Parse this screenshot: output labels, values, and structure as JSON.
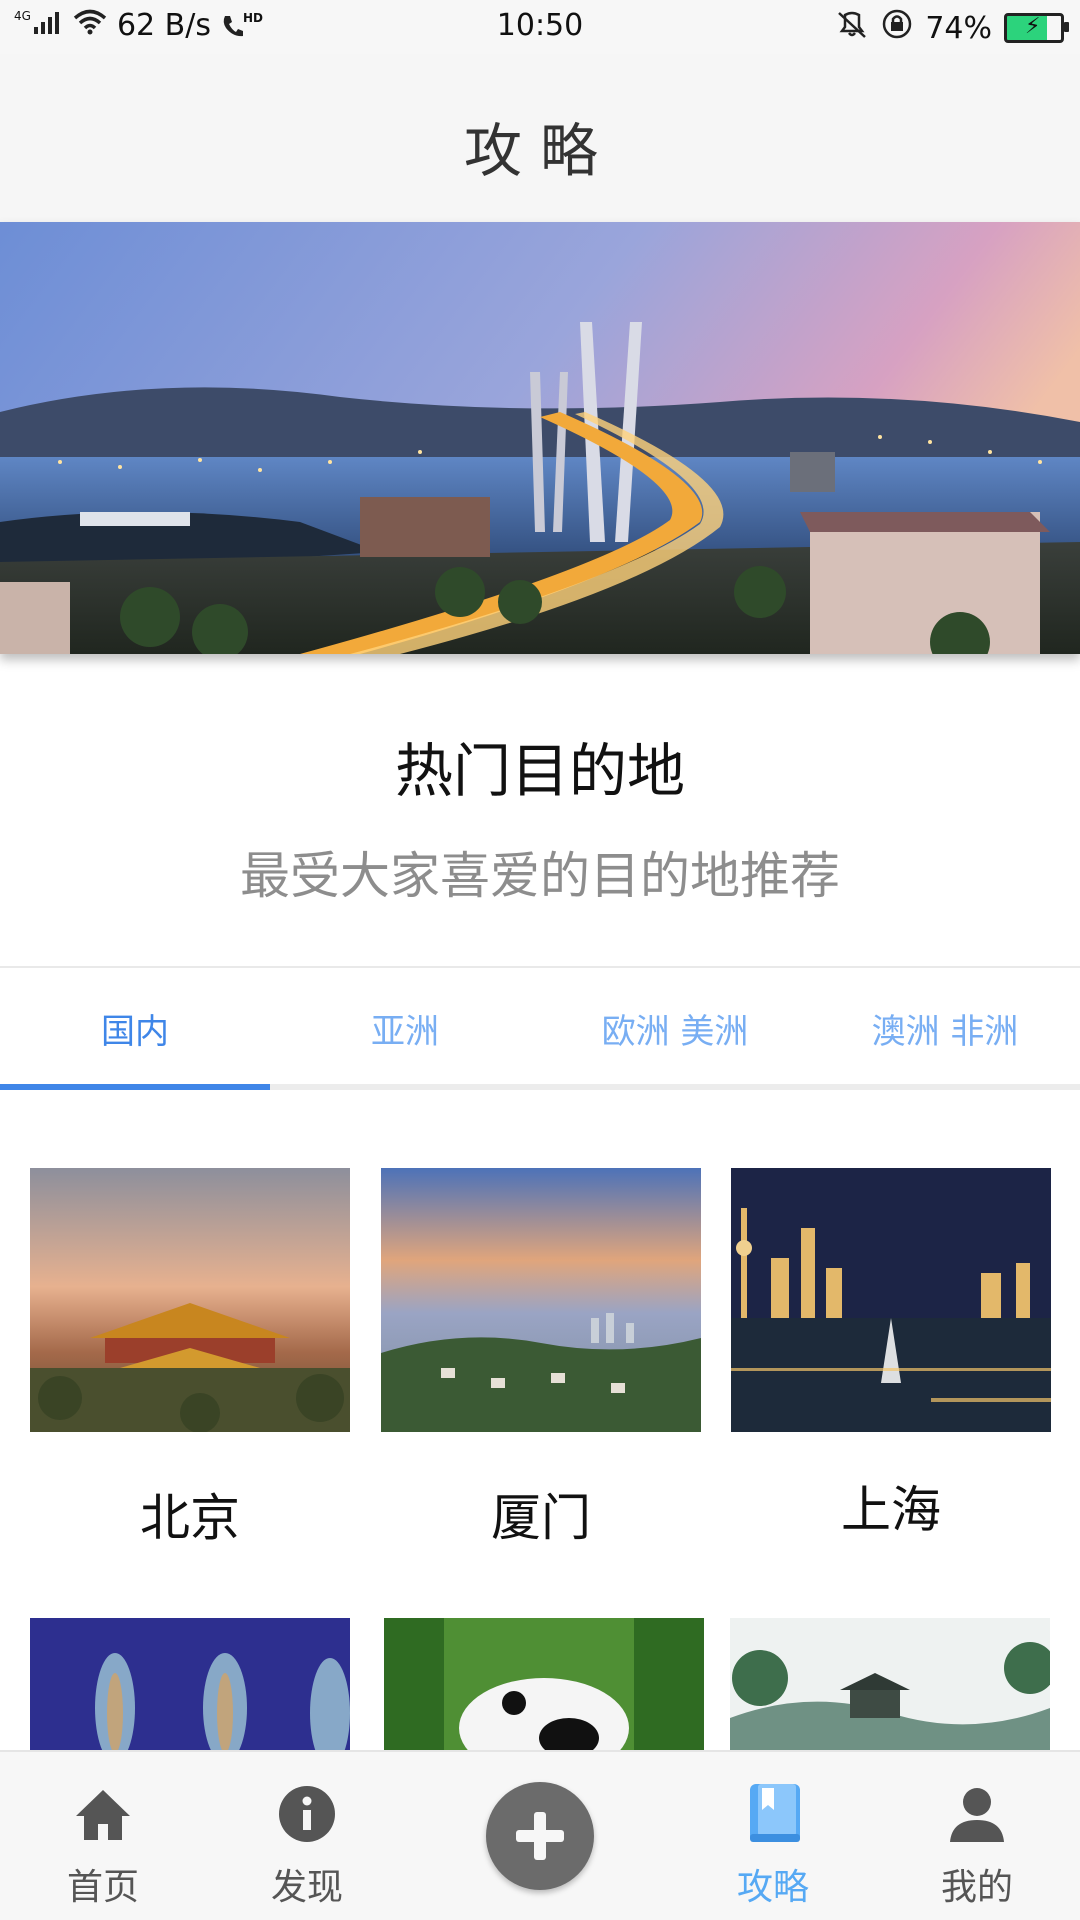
{
  "status_bar": {
    "network": "4G",
    "speed": "62 B/s",
    "hd": "HD",
    "time": "10:50",
    "battery": "74%",
    "battery_level": 0.74,
    "icons": [
      "signal-icon",
      "wifi-icon",
      "hd-call-icon",
      "vibrate-icon",
      "rotation-lock-icon",
      "battery-icon"
    ]
  },
  "header": {
    "title": "攻略"
  },
  "hot": {
    "title": "热门目的地",
    "subtitle": "最受大家喜爱的目的地推荐"
  },
  "tabs": [
    {
      "label": "国内",
      "active": true
    },
    {
      "label": "亚洲",
      "active": false
    },
    {
      "label": "欧洲 美洲",
      "active": false
    },
    {
      "label": "澳洲 非洲",
      "active": false
    }
  ],
  "destinations": [
    {
      "name": "北京"
    },
    {
      "name": "厦门"
    },
    {
      "name": "上海"
    },
    {
      "name": ""
    },
    {
      "name": ""
    },
    {
      "name": ""
    }
  ],
  "bottom_nav": {
    "items": [
      {
        "label": "首页",
        "icon": "home-icon",
        "active": false
      },
      {
        "label": "发现",
        "icon": "info-icon",
        "active": false
      },
      {
        "label": "",
        "icon": "plus-icon",
        "active": false
      },
      {
        "label": "攻略",
        "icon": "guide-book-icon",
        "active": true
      },
      {
        "label": "我的",
        "icon": "person-icon",
        "active": false
      }
    ]
  },
  "colors": {
    "accent": "#3f86e8",
    "tab_inactive": "#78aef3",
    "nav_active": "#56a9f4",
    "nav_inactive": "#555555",
    "subtitle": "#8d8d8d"
  }
}
